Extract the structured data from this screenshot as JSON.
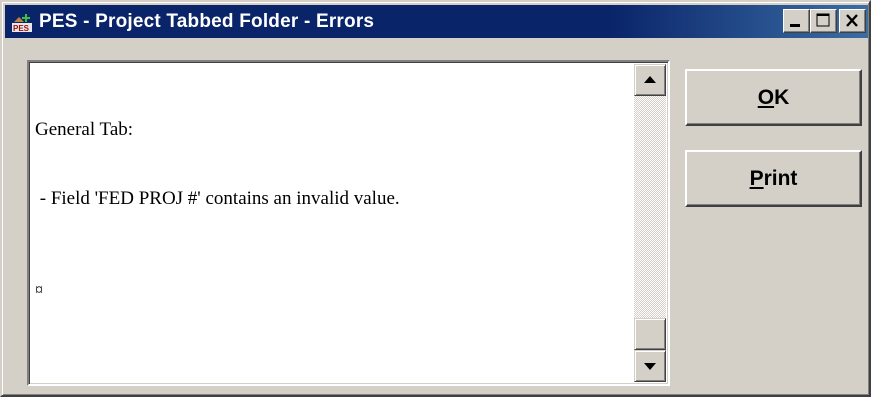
{
  "window": {
    "title": "PES - Project Tabbed Folder - Errors",
    "icon": "pes-app-icon",
    "icon_text": "PES",
    "controls": {
      "minimize_icon": "minimize-icon",
      "maximize_icon": "maximize-icon",
      "close_icon": "close-icon"
    },
    "colors": {
      "titlebar": "#0a246a",
      "face": "#d4d0c8"
    }
  },
  "errors_text": {
    "lines": [
      "General Tab:",
      " - Field 'FED PROJ #' contains an invalid value."
    ],
    "trailing_mark": "¤"
  },
  "scrollbar": {
    "up_icon": "arrow-up-icon",
    "down_icon": "arrow-down-icon"
  },
  "buttons": {
    "ok": {
      "mnemonic": "O",
      "rest": "K"
    },
    "print": {
      "mnemonic": "P",
      "rest": "rint"
    }
  }
}
